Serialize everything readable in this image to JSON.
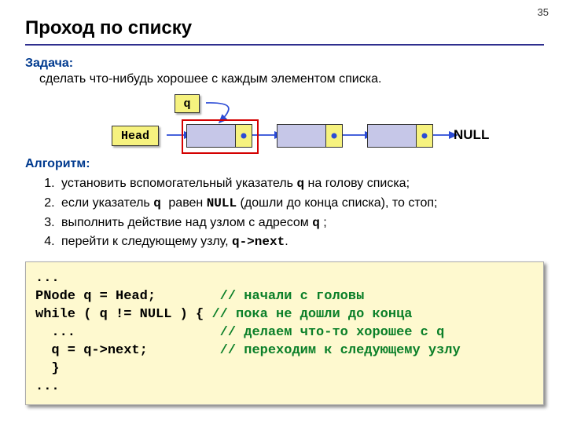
{
  "page_number": "35",
  "title": "Проход по списку",
  "task": {
    "label": "Задача:",
    "text": "сделать что-нибудь хорошее с каждым элементом списка."
  },
  "diagram": {
    "q_label": "q",
    "head_label": "Head",
    "null_label": "NULL"
  },
  "algorithm": {
    "label": "Алгоритм:",
    "items": {
      "a": {
        "pre": "установить вспомогательный указатель ",
        "code": "q",
        "post": " на голову списка;"
      },
      "b": {
        "pre": "если указатель ",
        "code": "q ",
        "mid": " равен ",
        "code2": "NULL",
        "post": " (дошли до конца списка), то стоп;"
      },
      "c": {
        "pre": "выполнить действие над узлом с адресом ",
        "code": "q",
        "post": " ;"
      },
      "d": {
        "pre": "перейти к следующему узлу, ",
        "code": "q->next",
        "post": "."
      }
    }
  },
  "code": {
    "l1": "...",
    "l2a": "PNode q = Head;        ",
    "l2c": "// начали с головы",
    "l3a": "while ( q != NULL ) { ",
    "l3c": "// пока не дошли до конца",
    "l4a": "  ...                  ",
    "l4c": "// делаем что-то хорошее с q",
    "l5a": "  q = q->next;         ",
    "l5c": "// переходим к следующему узлу",
    "l6": "  }",
    "l7": "..."
  }
}
